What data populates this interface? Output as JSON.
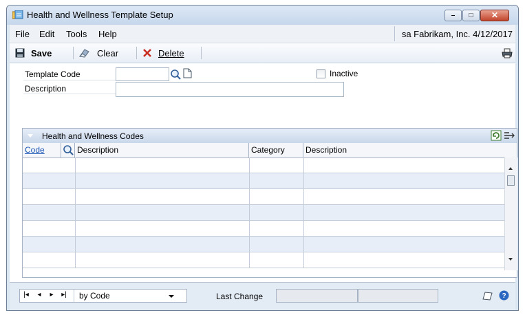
{
  "window": {
    "title": "Health and Wellness Template Setup"
  },
  "title_buttons": {
    "minimize": "–",
    "maximize": "□",
    "close": "✕"
  },
  "menu": {
    "items": [
      "File",
      "Edit",
      "Tools",
      "Help"
    ]
  },
  "company_info": "sa  Fabrikam, Inc. 4/12/2017",
  "toolbar": {
    "save": "Save",
    "clear": "Clear",
    "delete": "Delete"
  },
  "form": {
    "template_code_label": "Template Code",
    "description_label": "Description",
    "inactive_label": "Inactive",
    "template_code_value": "",
    "description_value": "",
    "inactive_checked": false
  },
  "grid": {
    "title": "Health and Wellness Codes",
    "columns": [
      "Code",
      "Description",
      "Category",
      "Description"
    ],
    "rows": [
      [
        "",
        "",
        "",
        ""
      ],
      [
        "",
        "",
        "",
        ""
      ],
      [
        "",
        "",
        "",
        ""
      ],
      [
        "",
        "",
        "",
        ""
      ],
      [
        "",
        "",
        "",
        ""
      ],
      [
        "",
        "",
        "",
        ""
      ],
      [
        "",
        "",
        "",
        ""
      ]
    ]
  },
  "footer": {
    "nav_buttons": [
      "|◂",
      "◂",
      "▸",
      "▸|"
    ],
    "sort_value": "by Code",
    "last_change_label": "Last Change",
    "last_change_value_1": "",
    "last_change_value_2": ""
  },
  "icons": {
    "app": "template-setup-icon",
    "save": "floppy-disk-icon",
    "clear": "eraser-icon",
    "delete": "delete-x-icon",
    "print": "printer-icon",
    "lookup": "magnifier-icon",
    "new": "new-document-icon",
    "note": "note-icon",
    "help": "help-icon"
  },
  "colors": {
    "accent": "#1a56b5",
    "close_button": "#c2452c",
    "delete_x": "#c82b1d"
  }
}
